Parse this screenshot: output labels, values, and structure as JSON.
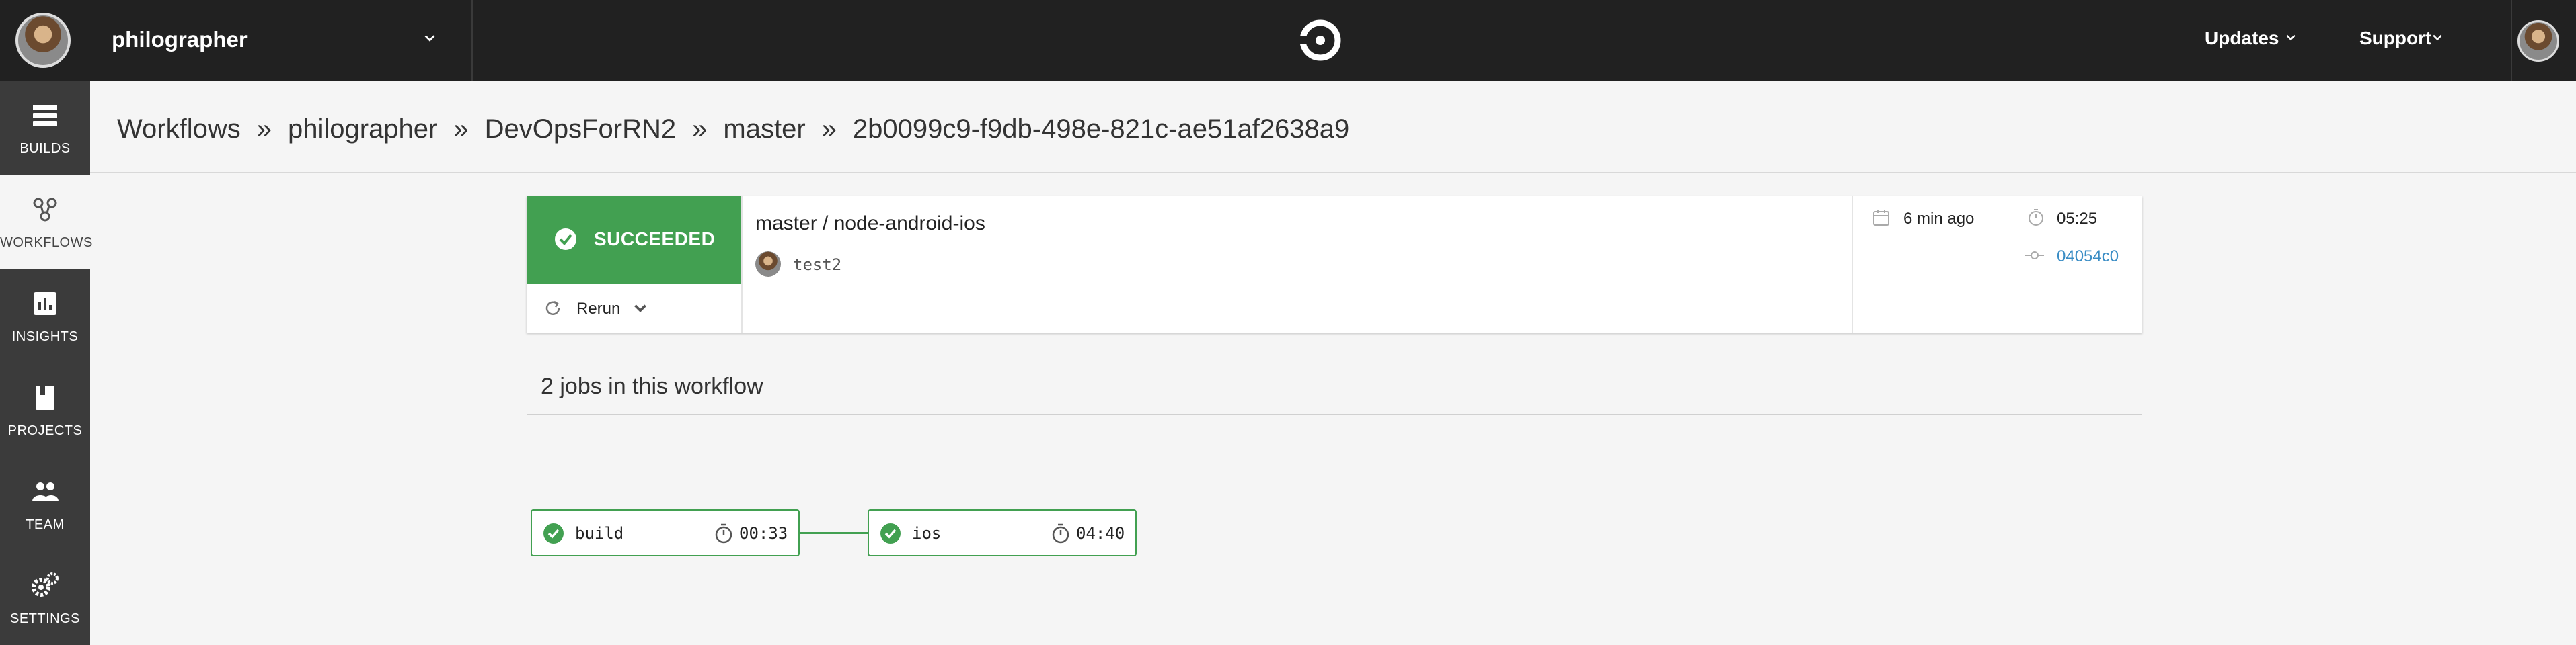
{
  "header": {
    "org_name": "philographer",
    "links": [
      {
        "label": "Updates"
      },
      {
        "label": "Support"
      }
    ]
  },
  "sidebar": {
    "items": [
      {
        "label": "BUILDS",
        "icon": "builds-icon"
      },
      {
        "label": "WORKFLOWS",
        "icon": "workflows-icon",
        "active": true
      },
      {
        "label": "INSIGHTS",
        "icon": "insights-icon"
      },
      {
        "label": "PROJECTS",
        "icon": "projects-icon"
      },
      {
        "label": "TEAM",
        "icon": "team-icon"
      },
      {
        "label": "SETTINGS",
        "icon": "settings-icon"
      }
    ]
  },
  "breadcrumb": {
    "items": [
      "Workflows",
      "philographer",
      "DevOpsForRN2",
      "master",
      "2b0099c9-f9db-498e-821c-ae51af2638a9"
    ],
    "separator": "»"
  },
  "workflow": {
    "status": "SUCCEEDED",
    "status_color": "#42a051",
    "rerun_label": "Rerun",
    "name": "master / node-android-ios",
    "commit_message": "test2",
    "started": "6 min ago",
    "duration": "05:25",
    "commit_hash": "04054c0"
  },
  "jobs": {
    "title": "2 jobs in this workflow",
    "items": [
      {
        "name": "build",
        "time": "00:33",
        "status": "success"
      },
      {
        "name": "ios",
        "time": "04:40",
        "status": "success"
      }
    ]
  },
  "colors": {
    "topbar": "#212121",
    "sidebar": "#3b3b3b",
    "success": "#42a051",
    "link": "#3a8dc5"
  }
}
